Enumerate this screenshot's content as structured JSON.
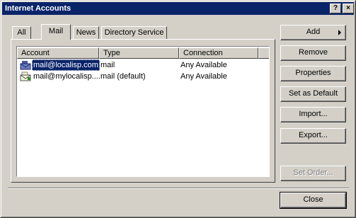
{
  "window": {
    "title": "Internet Accounts",
    "help_glyph": "?",
    "close_glyph": "×"
  },
  "tabs": [
    {
      "label": "All",
      "active": false
    },
    {
      "label": "Mail",
      "active": true
    },
    {
      "label": "News",
      "active": false
    },
    {
      "label": "Directory Service",
      "active": false
    }
  ],
  "list": {
    "columns": [
      "Account",
      "Type",
      "Connection"
    ],
    "rows": [
      {
        "account": "mail@localisp.com",
        "type": "mail",
        "connection": "Any Available",
        "selected": true,
        "icon": "mail-account-icon"
      },
      {
        "account": "mail@mylocalisp....",
        "type": "mail (default)",
        "connection": "Any Available",
        "selected": false,
        "icon": "default-mail-account-icon"
      }
    ]
  },
  "buttons": {
    "add": "Add",
    "remove": "Remove",
    "properties": "Properties",
    "set_default": "Set as Default",
    "import": "Import...",
    "export": "Export...",
    "set_order": "Set Order...",
    "close": "Close"
  },
  "colors": {
    "titlebar": "#0a246a",
    "face": "#d4d0c8",
    "selection": "#0a246a"
  }
}
